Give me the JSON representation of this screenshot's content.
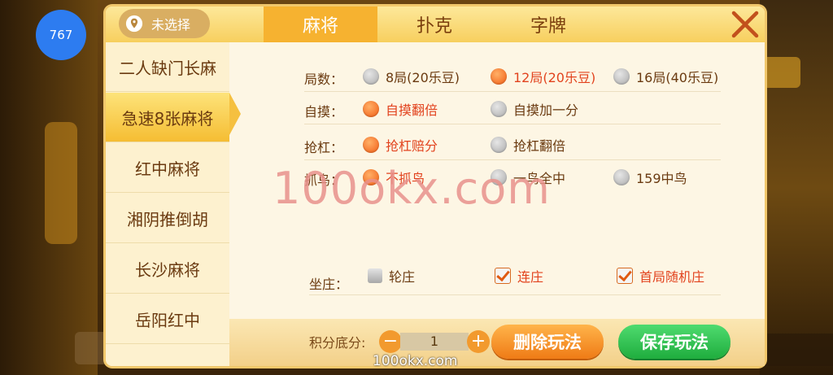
{
  "badge": {
    "count": "767"
  },
  "location": {
    "label": "未选择"
  },
  "tabs": [
    {
      "label": "麻将"
    },
    {
      "label": "扑克"
    },
    {
      "label": "字牌"
    }
  ],
  "sidebar": {
    "items": [
      {
        "label": "二人缺门长麻"
      },
      {
        "label": "急速8张麻将"
      },
      {
        "label": "红中麻将"
      },
      {
        "label": "湘阴推倒胡"
      },
      {
        "label": "长沙麻将"
      },
      {
        "label": "岳阳红中"
      }
    ]
  },
  "rules": {
    "rounds": {
      "label": "局数：",
      "options": [
        {
          "text": "8局(20乐豆)",
          "selected": false
        },
        {
          "text": "12局(20乐豆)",
          "selected": true
        },
        {
          "text": "16局(40乐豆)",
          "selected": false
        }
      ]
    },
    "zimo": {
      "label": "自摸：",
      "options": [
        {
          "text": "自摸翻倍",
          "selected": true
        },
        {
          "text": "自摸加一分",
          "selected": false
        }
      ]
    },
    "qianggang": {
      "label": "抢杠：",
      "options": [
        {
          "text": "抢杠赔分",
          "selected": true
        },
        {
          "text": "抢杠翻倍",
          "selected": false
        }
      ]
    },
    "zhuaniao": {
      "label": "抓鸟：",
      "options": [
        {
          "text": "不抓鸟",
          "selected": true
        },
        {
          "text": "一鸟全中",
          "selected": false
        },
        {
          "text": "159中鸟",
          "selected": false
        }
      ]
    },
    "zuozhuang": {
      "label": "坐庄：",
      "options": [
        {
          "text": "轮庄",
          "checked": false
        },
        {
          "text": "连庄",
          "checked": true
        },
        {
          "text": "首局随机庄",
          "checked": true
        }
      ]
    }
  },
  "footer": {
    "score_label": "积分底分:",
    "score_value": "1",
    "minus": "−",
    "plus": "+",
    "delete_label": "删除玩法",
    "save_label": "保存玩法"
  },
  "watermark": "100okx.com",
  "site": "100okx.com",
  "colors": {
    "accent": "#f6b230",
    "selected_text": "#e2431e",
    "save": "#1fad3e",
    "delete": "#ef7b16",
    "badge": "#2d7cf0"
  }
}
